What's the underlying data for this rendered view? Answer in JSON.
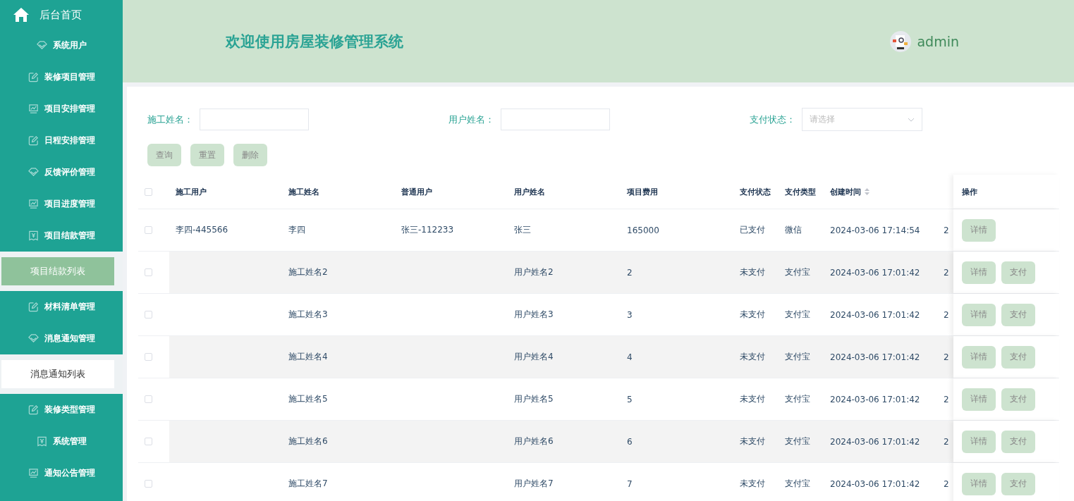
{
  "sidebar": {
    "home": {
      "label": "后台首页"
    },
    "items": [
      {
        "label": "系统用户",
        "kind": "diamond"
      },
      {
        "label": "装修项目管理",
        "kind": "edit"
      },
      {
        "label": "项目安排管理",
        "kind": "chart"
      },
      {
        "label": "日程安排管理",
        "kind": "edit"
      },
      {
        "label": "反馈评价管理",
        "kind": "diamond"
      },
      {
        "label": "项目进度管理",
        "kind": "chart"
      },
      {
        "label": "项目结款管理",
        "kind": "bill",
        "children": [
          {
            "label": "项目结款列表",
            "selected": true
          }
        ]
      },
      {
        "label": "材料清单管理",
        "kind": "edit"
      },
      {
        "label": "消息通知管理",
        "kind": "diamond",
        "children": [
          {
            "label": "消息通知列表",
            "selected": false
          }
        ]
      },
      {
        "label": "装修类型管理",
        "kind": "edit"
      },
      {
        "label": "系统管理",
        "kind": "bill"
      },
      {
        "label": "通知公告管理",
        "kind": "chart"
      }
    ]
  },
  "header": {
    "title": "欢迎使用房屋装修管理系统",
    "user": "admin"
  },
  "search": {
    "fields": [
      {
        "label": "施工姓名：",
        "kind": "input"
      },
      {
        "label": "用户姓名：",
        "kind": "input"
      },
      {
        "label": "支付状态：",
        "kind": "select",
        "placeholder": "请选择"
      }
    ],
    "buttons": [
      "查询",
      "重置",
      "删除"
    ]
  },
  "table": {
    "all_checked": false,
    "columns": [
      "施工用户",
      "施工姓名",
      "普通用户",
      "用户姓名",
      "项目费用",
      "支付状态",
      "支付类型",
      "创建时间",
      "操作"
    ],
    "rows": [
      {
        "checked": false,
        "cells": [
          "李四-445566",
          "李四",
          "张三-112233",
          "张三",
          "165000",
          "已支付",
          "微信",
          "2024-03-06 17:14:54",
          "2"
        ],
        "actions": [
          "详情"
        ]
      },
      {
        "checked": false,
        "cells": [
          "",
          "施工姓名2",
          "",
          "用户姓名2",
          "2",
          "未支付",
          "支付宝",
          "2024-03-06 17:01:42",
          "2"
        ],
        "actions": [
          "详情",
          "支付"
        ]
      },
      {
        "checked": false,
        "cells": [
          "",
          "施工姓名3",
          "",
          "用户姓名3",
          "3",
          "未支付",
          "支付宝",
          "2024-03-06 17:01:42",
          "2"
        ],
        "actions": [
          "详情",
          "支付"
        ]
      },
      {
        "checked": false,
        "cells": [
          "",
          "施工姓名4",
          "",
          "用户姓名4",
          "4",
          "未支付",
          "支付宝",
          "2024-03-06 17:01:42",
          "2"
        ],
        "actions": [
          "详情",
          "支付"
        ]
      },
      {
        "checked": false,
        "cells": [
          "",
          "施工姓名5",
          "",
          "用户姓名5",
          "5",
          "未支付",
          "支付宝",
          "2024-03-06 17:01:42",
          "2"
        ],
        "actions": [
          "详情",
          "支付"
        ]
      },
      {
        "checked": false,
        "cells": [
          "",
          "施工姓名6",
          "",
          "用户姓名6",
          "6",
          "未支付",
          "支付宝",
          "2024-03-06 17:01:42",
          "2"
        ],
        "actions": [
          "详情",
          "支付"
        ]
      },
      {
        "checked": false,
        "cells": [
          "",
          "施工姓名7",
          "",
          "用户姓名7",
          "7",
          "未支付",
          "支付宝",
          "2024-03-06 17:01:42",
          "2"
        ],
        "actions": [
          "详情",
          "支付"
        ]
      }
    ]
  }
}
